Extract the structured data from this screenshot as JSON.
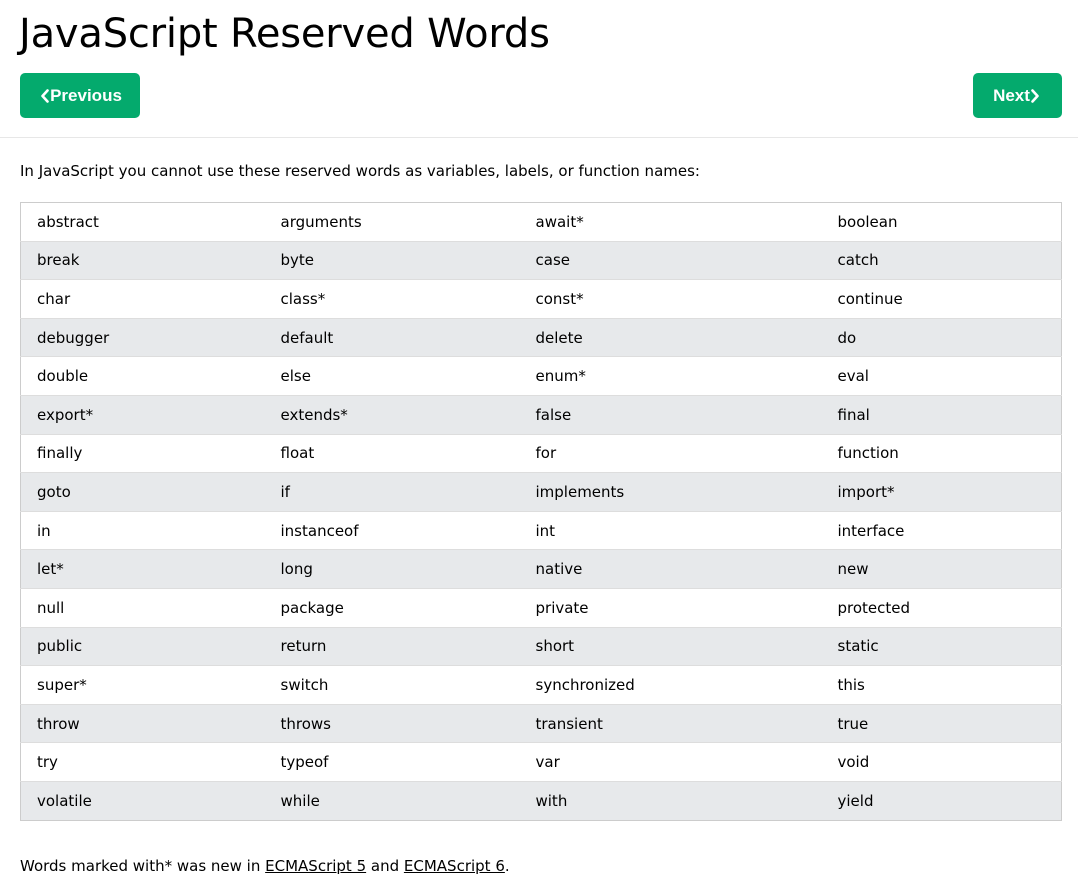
{
  "page_title": "JavaScript Reserved Words",
  "nav": {
    "previous_label": "Previous",
    "next_label": "Next",
    "button_color": "#04AA6D"
  },
  "intro_text": "In JavaScript you cannot use these reserved words as variables, labels, or function names:",
  "table": {
    "rows": [
      [
        "abstract",
        "arguments",
        "await*",
        "boolean"
      ],
      [
        "break",
        "byte",
        "case",
        "catch"
      ],
      [
        "char",
        "class*",
        "const*",
        "continue"
      ],
      [
        "debugger",
        "default",
        "delete",
        "do"
      ],
      [
        "double",
        "else",
        "enum*",
        "eval"
      ],
      [
        "export*",
        "extends*",
        "false",
        "final"
      ],
      [
        "finally",
        "float",
        "for",
        "function"
      ],
      [
        "goto",
        "if",
        "implements",
        "import*"
      ],
      [
        "in",
        "instanceof",
        "int",
        "interface"
      ],
      [
        "let*",
        "long",
        "native",
        "new"
      ],
      [
        "null",
        "package",
        "private",
        "protected"
      ],
      [
        "public",
        "return",
        "short",
        "static"
      ],
      [
        "super*",
        "switch",
        "synchronized",
        "this"
      ],
      [
        "throw",
        "throws",
        "transient",
        "true"
      ],
      [
        "try",
        "typeof",
        "var",
        "void"
      ],
      [
        "volatile",
        "while",
        "with",
        "yield"
      ]
    ],
    "stripe_color": "#e7e9eb"
  },
  "footnote": {
    "prefix": "Words marked with* was new in ",
    "link1": "ECMAScript 5",
    "middle": " and ",
    "link2": "ECMAScript 6",
    "suffix": "."
  },
  "icons": {
    "previous": "chevron-left-icon",
    "next": "chevron-right-icon"
  }
}
